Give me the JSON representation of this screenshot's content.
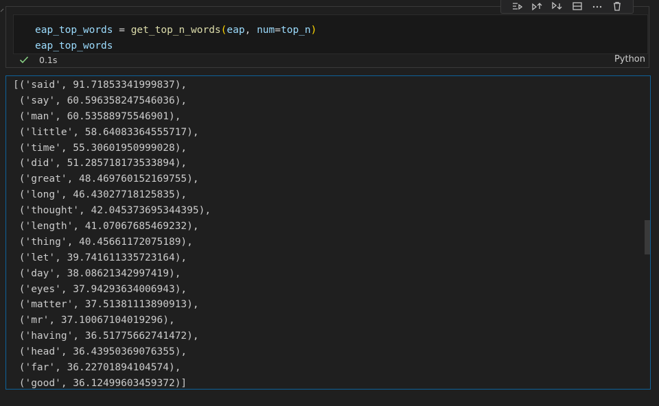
{
  "cell": {
    "code_lines": [
      {
        "tokens": [
          {
            "text": "eap_top_words",
            "kind": "var"
          },
          {
            "text": " = ",
            "kind": "op"
          },
          {
            "text": "get_top_n_words",
            "kind": "fn"
          },
          {
            "text": "(",
            "kind": "paren"
          },
          {
            "text": "eap",
            "kind": "var"
          },
          {
            "text": ", ",
            "kind": "op"
          },
          {
            "text": "num",
            "kind": "var"
          },
          {
            "text": "=",
            "kind": "op"
          },
          {
            "text": "top_n",
            "kind": "var"
          },
          {
            "text": ")",
            "kind": "paren"
          }
        ]
      },
      {
        "tokens": [
          {
            "text": "eap_top_words",
            "kind": "var"
          }
        ]
      }
    ],
    "exec_time": "0.1s",
    "language": "Python",
    "toolbar_icons": [
      "run-by-line-icon",
      "execute-above-icon",
      "execute-below-icon",
      "split-cell-icon",
      "more-actions-icon",
      "delete-icon"
    ]
  },
  "output": {
    "lines": [
      "[('said', 91.71853341999837),",
      " ('say', 60.596358247546036),",
      " ('man', 60.53588975546901),",
      " ('little', 58.64083364555717),",
      " ('time', 55.30601950999028),",
      " ('did', 51.285718173533894),",
      " ('great', 48.469760152169755),",
      " ('long', 46.43027718125835),",
      " ('thought', 42.045373695344395),",
      " ('length', 41.07067685469232),",
      " ('thing', 40.45661172075189),",
      " ('let', 39.741611335723164),",
      " ('day', 38.08621342997419),",
      " ('eyes', 37.94293634006943),",
      " ('matter', 37.51381113890913),",
      " ('mr', 37.10067104019296),",
      " ('having', 36.51775662741472),",
      " ('head', 36.43950369076355),",
      " ('far', 36.22701894104574),",
      " ('good', 36.12499603459372)]"
    ]
  },
  "colors": {
    "background": "#1f1f1f",
    "focus_border": "#0e639c",
    "success_check": "#89d185"
  }
}
